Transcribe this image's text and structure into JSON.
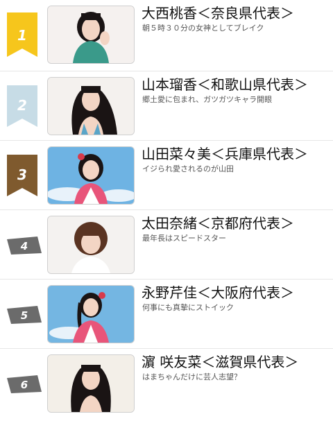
{
  "ranking": [
    {
      "rank": "1",
      "name": "大西桃香＜奈良県代表＞",
      "desc": "朝５時３０分の女神としてブレイク",
      "badge_color": "#f6c61c",
      "badge_shape": "ribbon",
      "photo_bg": "#f5f1ef"
    },
    {
      "rank": "2",
      "name": "山本瑠香＜和歌山県代表＞",
      "desc": "郷土愛に包まれ、ガツガツキャラ開眼",
      "badge_color": "#c7dce6",
      "badge_shape": "ribbon",
      "photo_bg": "#f4f1ee"
    },
    {
      "rank": "3",
      "name": "山田菜々美＜兵庫県代表＞",
      "desc": "イジられ愛されるのが山田",
      "badge_color": "#7f5a2e",
      "badge_shape": "ribbon",
      "photo_bg": "#6eb3e3"
    },
    {
      "rank": "4",
      "name": "太田奈緒＜京都府代表＞",
      "desc": "最年長はスピードスター",
      "badge_color": "#6b6b6b",
      "badge_shape": "tab",
      "photo_bg": "#f4f2f0"
    },
    {
      "rank": "5",
      "name": "永野芹佳＜大阪府代表＞",
      "desc": "何事にも真摯にストイック",
      "badge_color": "#6b6b6b",
      "badge_shape": "tab",
      "photo_bg": "#74b6e2"
    },
    {
      "rank": "6",
      "name": "濵 咲友菜＜滋賀県代表＞",
      "desc": "はまちゃんだけに芸人志望？",
      "badge_color": "#6b6b6b",
      "badge_shape": "tab",
      "photo_bg": "#f3efe8"
    }
  ]
}
